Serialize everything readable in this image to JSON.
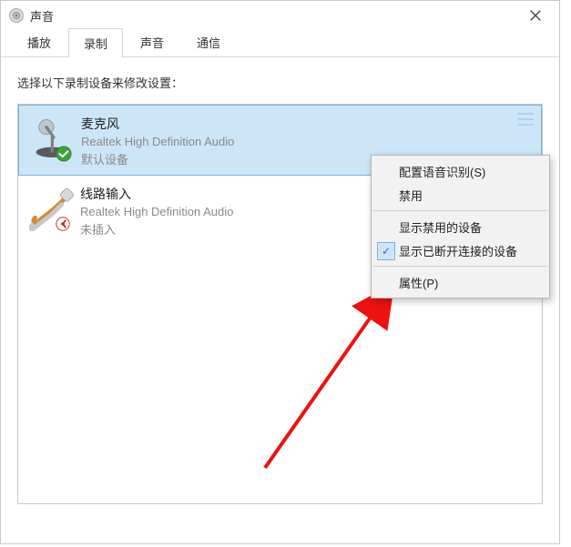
{
  "window": {
    "title": "声音"
  },
  "tabs": {
    "playback": "播放",
    "recording": "录制",
    "sounds": "声音",
    "communications": "通信",
    "active": "recording"
  },
  "instructions": "选择以下录制设备来修改设置：",
  "devices": [
    {
      "name": "麦克风",
      "provider": "Realtek High Definition Audio",
      "status": "默认设备",
      "selected": true,
      "badge": "ok"
    },
    {
      "name": "线路输入",
      "provider": "Realtek High Definition Audio",
      "status": "未插入",
      "selected": false,
      "badge": "unplugged"
    }
  ],
  "context_menu": {
    "configure_speech": "配置语音识别(S)",
    "disable": "禁用",
    "show_disabled": "显示禁用的设备",
    "show_disconnected": "显示已断开连接的设备",
    "show_disconnected_checked": true,
    "properties": "属性(P)"
  }
}
